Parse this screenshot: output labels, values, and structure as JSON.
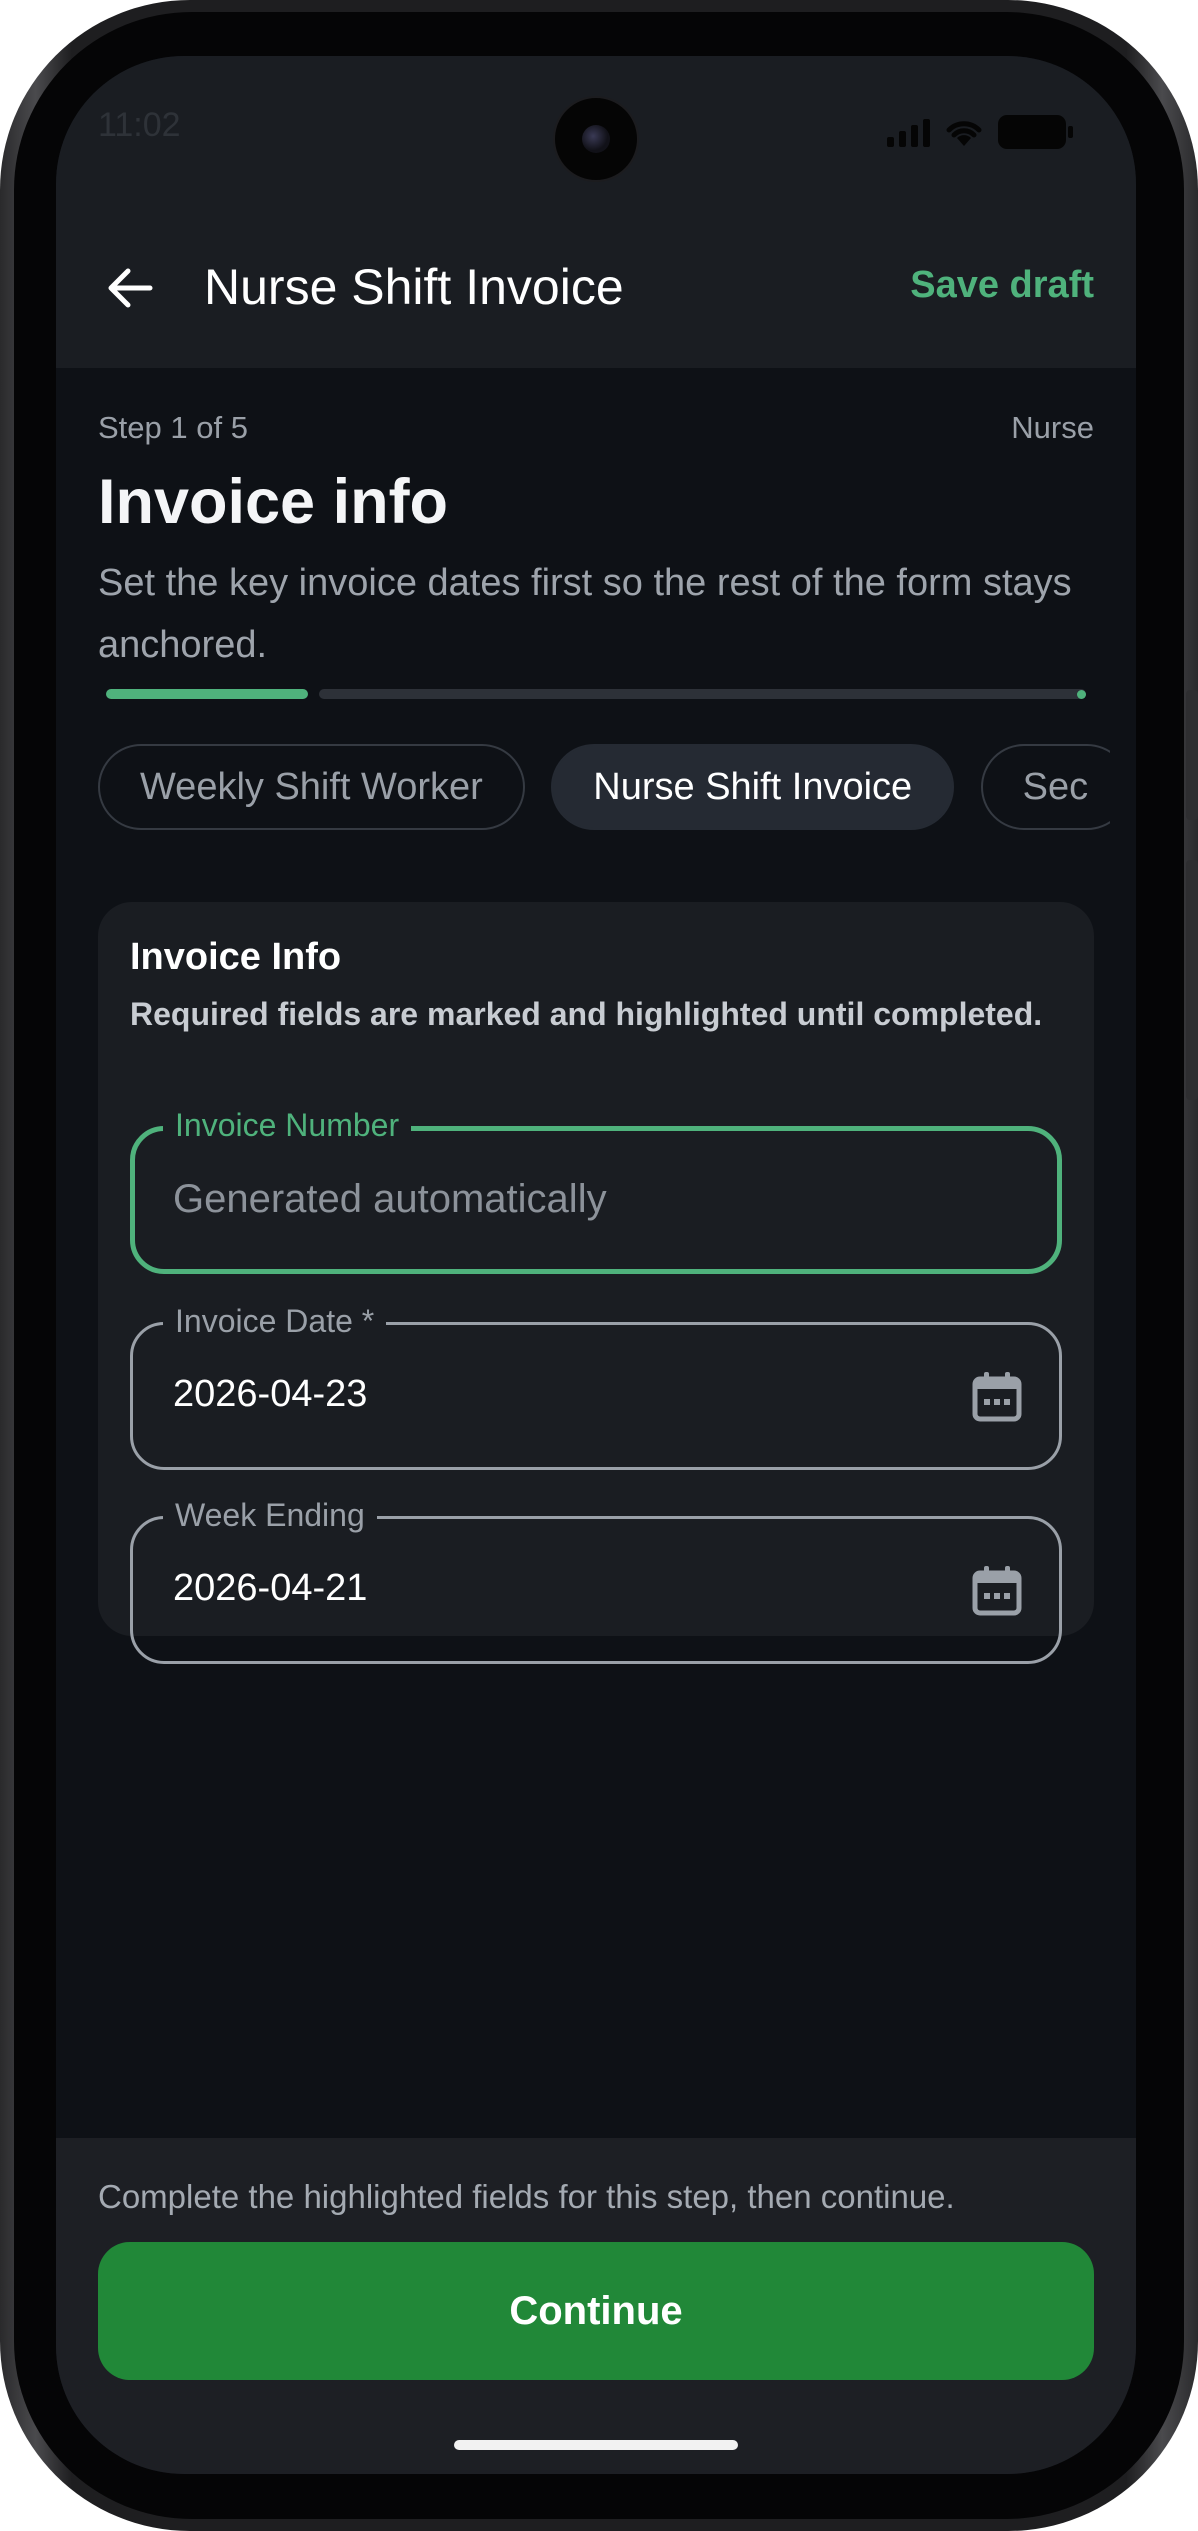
{
  "status_bar": {
    "time": "11:02"
  },
  "app_bar": {
    "title": "Nurse Shift Invoice",
    "save_label": "Save draft"
  },
  "step": {
    "counter": "Step 1 of 5",
    "role": "Nurse",
    "title": "Invoice info",
    "description": "Set the key invoice dates first so the rest of the form stays anchored.",
    "progress_fraction": 0.2
  },
  "template_chips": [
    {
      "label": "Weekly Shift Worker",
      "active": false
    },
    {
      "label": "Nurse Shift Invoice",
      "active": true
    },
    {
      "label": "Sec",
      "active": false
    }
  ],
  "card": {
    "title": "Invoice Info",
    "subtitle": "Required fields are marked and highlighted until completed.",
    "fields": {
      "invoice_number": {
        "label": "Invoice Number",
        "placeholder": "Generated automatically",
        "value": ""
      },
      "invoice_date": {
        "label": "Invoice Date *",
        "value": "2026-04-23",
        "icon": "calendar-icon"
      },
      "week_ending": {
        "label": "Week Ending",
        "value": "2026-04-21",
        "icon": "calendar-icon"
      }
    }
  },
  "footer": {
    "hint": "Complete the highlighted fields for this step, then continue.",
    "continue_label": "Continue"
  },
  "colors": {
    "accent": "#4fb27c",
    "primary_button": "#218838",
    "background": "#0e1116",
    "surface": "#1a1d22"
  }
}
